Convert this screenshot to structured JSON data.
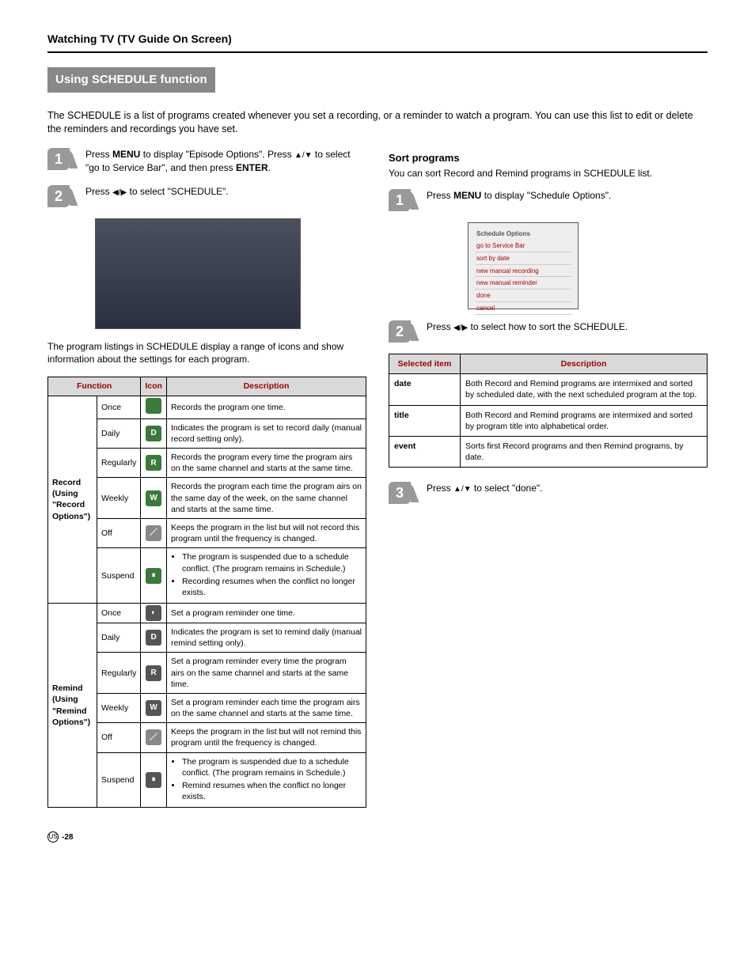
{
  "header": {
    "breadcrumb": "Watching TV (TV Guide On Screen)"
  },
  "section": {
    "title": "Using SCHEDULE function",
    "intro": "The SCHEDULE is a list of programs created whenever you set a recording, or a reminder to watch a program. You can use this list to edit or delete the reminders and recordings you have set."
  },
  "left": {
    "step1_pre": "Press ",
    "step1_menu": "MENU",
    "step1_mid": " to display \"Episode Options\". Press ",
    "step1_mid2": " to select \"go to Service Bar\", and then press ",
    "step1_enter": "ENTER",
    "step1_end": ".",
    "step2_pre": "Press ",
    "step2_end": " to select \"SCHEDULE\".",
    "caption": "The program listings in SCHEDULE display a range of icons and show information about the settings for each program.",
    "table": {
      "head": {
        "function": "Function",
        "icon": "Icon",
        "description": "Description"
      },
      "record_group": "Record (Using \"Record Options\")",
      "remind_group": "Remind (Using \"Remind Options\")",
      "rows_record": [
        {
          "f": "Once",
          "d": "Records the program one time."
        },
        {
          "f": "Daily",
          "d": "Indicates the program is set to record daily (manual record setting only)."
        },
        {
          "f": "Regularly",
          "d": "Records the program every time the program airs on the same channel and starts at the same time."
        },
        {
          "f": "Weekly",
          "d": "Records the program each time the program airs on the same day of the week, on the same channel and starts at the same time."
        },
        {
          "f": "Off",
          "d": "Keeps the program in the list but will not record this program until the frequency is changed."
        },
        {
          "f": "Suspend",
          "d1": "The program is suspended due to a schedule conflict. (The program remains in Schedule.)",
          "d2": "Recording resumes when the conflict no longer exists."
        }
      ],
      "rows_remind": [
        {
          "f": "Once",
          "d": "Set a program reminder one time."
        },
        {
          "f": "Daily",
          "d": "Indicates the program is set to remind daily (manual remind setting only)."
        },
        {
          "f": "Regularly",
          "d": "Set a program reminder every time the program airs on the same channel and starts at the same time."
        },
        {
          "f": "Weekly",
          "d": "Set a program reminder each time the program airs on the same channel and starts at the same time."
        },
        {
          "f": "Off",
          "d": "Keeps the program in the list but will not remind this program until the frequency is changed."
        },
        {
          "f": "Suspend",
          "d1": "The program is suspended due to a schedule conflict. (The program remains in Schedule.)",
          "d2": "Remind resumes when the conflict no longer exists."
        }
      ]
    }
  },
  "right": {
    "sort_heading": "Sort programs",
    "sort_intro": "You can sort Record and Remind programs in SCHEDULE list.",
    "step1_pre": "Press ",
    "step1_menu": "MENU",
    "step1_end": " to display \"Schedule Options\".",
    "menu": {
      "title": "Schedule Options",
      "items": [
        "go to Service Bar",
        "sort by    date",
        "new manual recording",
        "new manual reminder",
        "done",
        "cancel"
      ]
    },
    "step2_pre": "Press ",
    "step2_end": " to select how to sort the SCHEDULE.",
    "table": {
      "head": {
        "selected": "Selected item",
        "description": "Description"
      },
      "rows": [
        {
          "k": "date",
          "v": "Both Record and Remind programs are intermixed and sorted by scheduled date, with the next scheduled program at the top."
        },
        {
          "k": "title",
          "v": "Both Record and Remind programs are intermixed and sorted by program title into alphabetical order."
        },
        {
          "k": "event",
          "v": "Sorts first Record programs and then Remind programs, by date."
        }
      ]
    },
    "step3_pre": "Press ",
    "step3_end": " to select \"done\"."
  },
  "footer": {
    "region": "US",
    "page": "-28"
  }
}
